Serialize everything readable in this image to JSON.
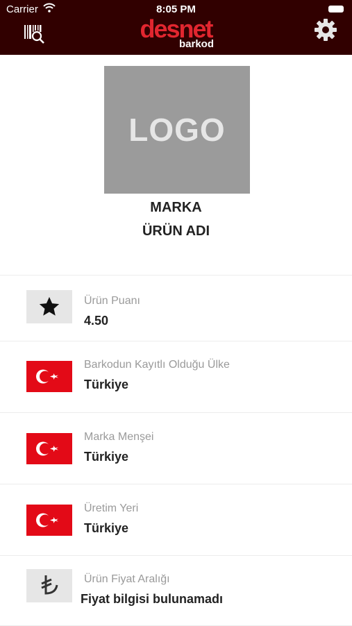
{
  "status_bar": {
    "carrier": "Carrier",
    "time": "8:05 PM"
  },
  "header": {
    "brand": "desnet",
    "brand_sub": "barkod",
    "accent": "#e1262f",
    "background": "#310000"
  },
  "product": {
    "logo_text": "LOGO",
    "brand": "MARKA",
    "name": "ÜRÜN ADI"
  },
  "details": [
    {
      "icon": "star-icon",
      "label": "Ürün Puanı",
      "value": "4.50"
    },
    {
      "icon": "turkey-flag-icon",
      "label": "Barkodun Kayıtlı Olduğu Ülke",
      "value": "Türkiye"
    },
    {
      "icon": "turkey-flag-icon",
      "label": "Marka Menşei",
      "value": "Türkiye"
    },
    {
      "icon": "turkey-flag-icon",
      "label": "Üretim Yeri",
      "value": "Türkiye"
    },
    {
      "icon": "lira-icon",
      "label": "Ürün Fiyat Aralığı",
      "value": "Fiyat bilgisi bulunamadı"
    }
  ]
}
